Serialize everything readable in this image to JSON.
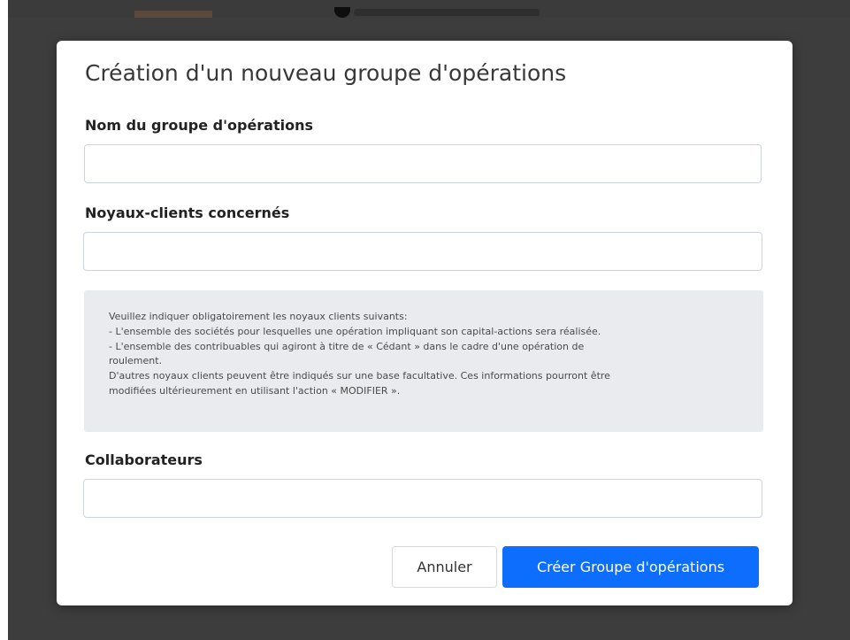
{
  "colors": {
    "overlay": "#3d3d3d",
    "modal_background": "#ffffff",
    "info_background": "#e9ebee",
    "primary": "#0d6efd"
  },
  "modal": {
    "title": "Création d'un nouveau groupe d'opérations",
    "fields": {
      "group_name": {
        "label": "Nom du groupe d'opérations",
        "value": ""
      },
      "client_cores": {
        "label": "Noyaux-clients concernés",
        "value": ""
      },
      "collaborators": {
        "label": "Collaborateurs",
        "value": ""
      }
    },
    "info": {
      "lines": [
        "Veuillez indiquer obligatoirement les noyaux clients suivants:",
        "- L'ensemble des sociétés pour lesquelles une opération impliquant son capital-actions sera réalisée.",
        "- L'ensemble des contribuables qui agiront à titre de « Cédant » dans le cadre d'une opération de",
        "roulement.",
        "D'autres noyaux clients peuvent être indiqués sur une base facultative. Ces informations pourront être",
        "modifiées ultérieurement en utilisant l'action « MODIFIER »."
      ]
    },
    "buttons": {
      "cancel": "Annuler",
      "create": "Créer Groupe d'opérations"
    }
  }
}
